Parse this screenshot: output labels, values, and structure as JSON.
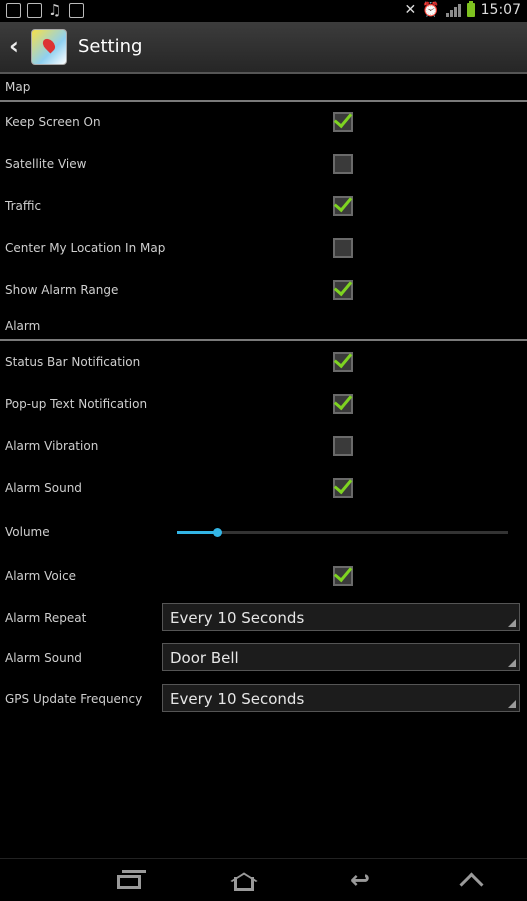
{
  "status_bar": {
    "time": "15:07"
  },
  "action_bar": {
    "title": "Setting"
  },
  "sections": {
    "map": {
      "title": "Map",
      "items": [
        {
          "label": "Keep Screen On",
          "checked": true
        },
        {
          "label": "Satellite View",
          "checked": false
        },
        {
          "label": "Traffic",
          "checked": true
        },
        {
          "label": "Center My Location In Map",
          "checked": false
        },
        {
          "label": "Show Alarm Range",
          "checked": true
        }
      ]
    },
    "alarm": {
      "title": "Alarm",
      "items": [
        {
          "label": "Status Bar Notification",
          "checked": true
        },
        {
          "label": "Pop-up Text Notification",
          "checked": true
        },
        {
          "label": "Alarm Vibration",
          "checked": false
        },
        {
          "label": "Alarm Sound",
          "checked": true
        }
      ],
      "volume": {
        "label": "Volume",
        "value": 0.12
      },
      "alarm_voice": {
        "label": "Alarm Voice",
        "checked": true
      },
      "alarm_repeat": {
        "label": "Alarm Repeat",
        "value": "Every 10 Seconds"
      },
      "alarm_sound_select": {
        "label": "Alarm Sound",
        "value": "Door Bell"
      },
      "gps_update": {
        "label": "GPS Update Frequency",
        "value": "Every 10 Seconds"
      }
    }
  },
  "colors": {
    "check": "#7ed321",
    "slider": "#33b5e5",
    "background": "#000000"
  }
}
